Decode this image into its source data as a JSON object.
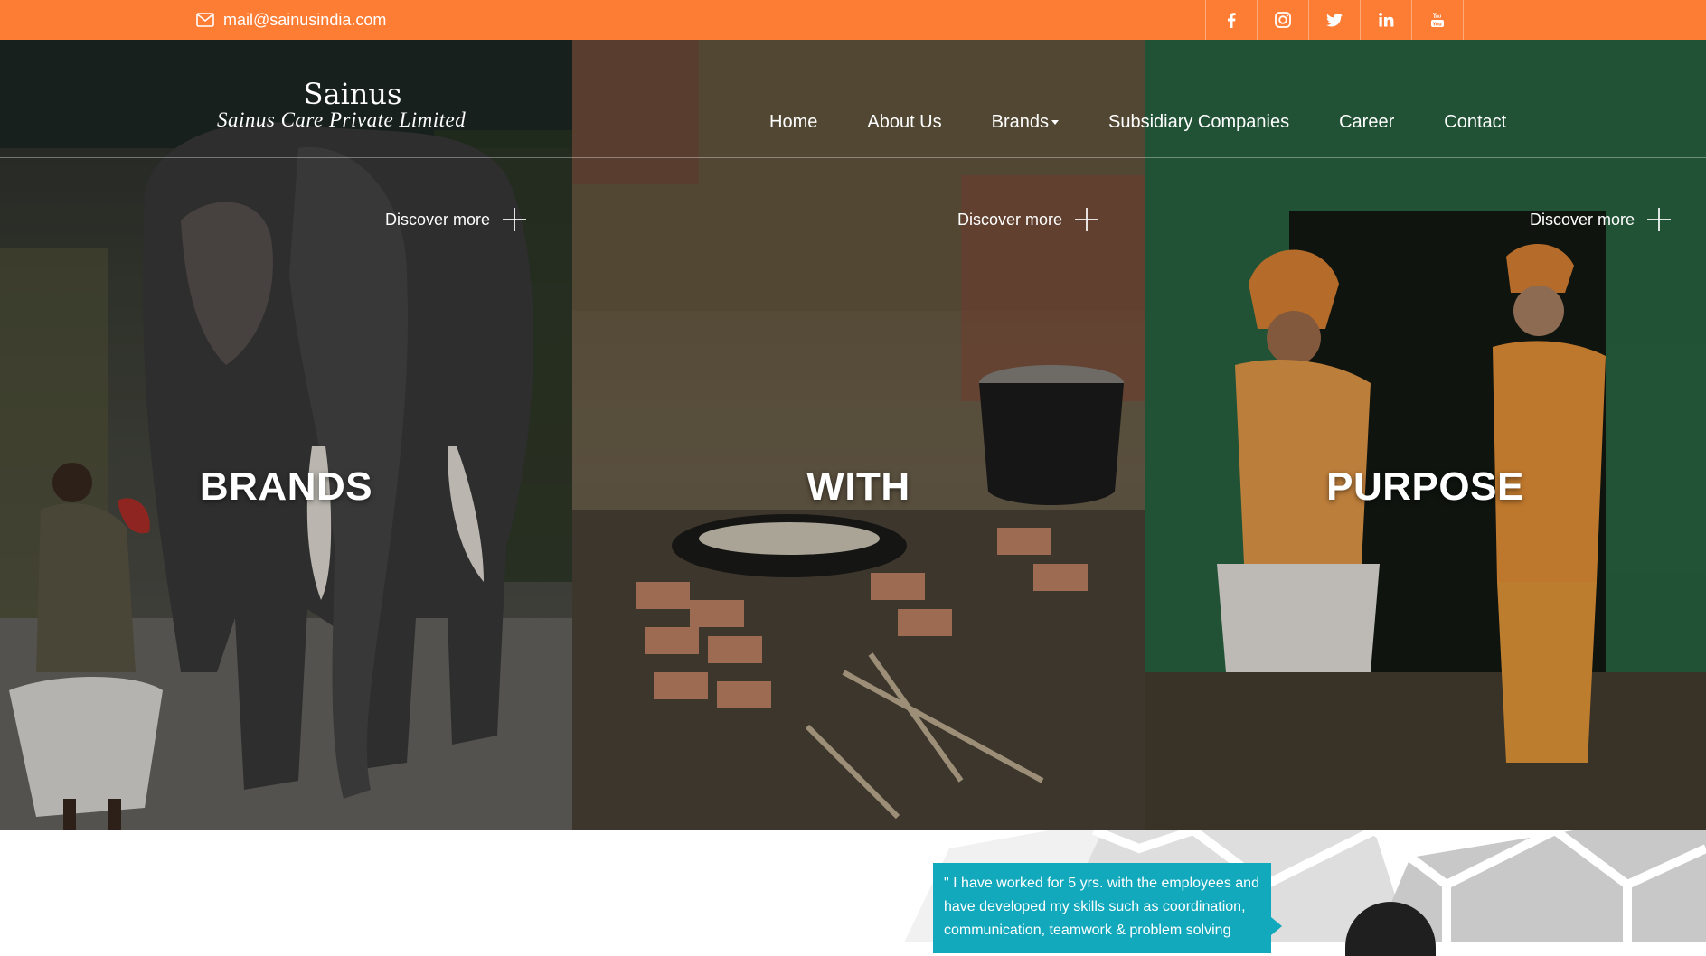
{
  "topbar": {
    "email": "mail@sainusindia.com",
    "social_icons": [
      "facebook-icon",
      "instagram-icon",
      "twitter-icon",
      "linkedin-icon",
      "youtube-icon"
    ],
    "background_color": "#fd7d35"
  },
  "header": {
    "logo_brand": "Sainus",
    "logo_tagline": "Sainus Care Private Limited",
    "nav": [
      "Home",
      "About Us",
      "Brands",
      "Subsidiary Companies",
      "Career",
      "Contact"
    ]
  },
  "hero": {
    "panels": [
      {
        "word": "BRANDS",
        "discover": "Discover more"
      },
      {
        "word": "WITH",
        "discover": "Discover more"
      },
      {
        "word": "PURPOSE",
        "discover": "Discover more"
      }
    ]
  },
  "testimonial": {
    "text": "\" I have worked for 5 yrs. with the employees and have developed my skills such as coordination, communication, teamwork & problem solving",
    "accent_color": "#12a9bd"
  }
}
